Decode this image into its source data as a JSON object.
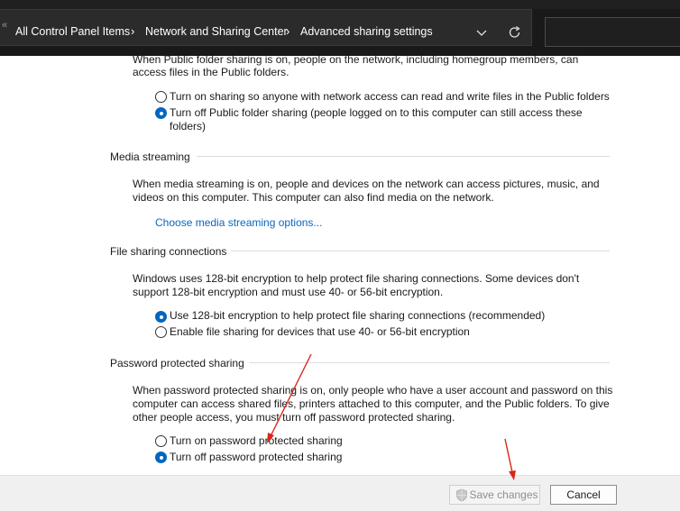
{
  "address_bar": {
    "breadcrumbs": [
      {
        "label": "All Control Panel Items"
      },
      {
        "label": "Network and Sharing Center"
      },
      {
        "label": "Advanced sharing settings"
      }
    ],
    "overflow_glyph": "«",
    "separator_glyph": "›",
    "dropdown_icon": "chevron-down-icon",
    "refresh_icon": "refresh-icon",
    "search_placeholder": ""
  },
  "public_folder": {
    "description_lines": [
      "When Public folder sharing is on, people on the network, including homegroup members, can",
      "access files in the Public folders."
    ],
    "options": [
      {
        "label": "Turn on sharing so anyone with network access can read and write files in the Public folders",
        "checked": false
      },
      {
        "label_lines": [
          "Turn off Public folder sharing (people logged on to this computer can still access these",
          "folders)"
        ],
        "checked": true
      }
    ]
  },
  "media_streaming": {
    "title": "Media streaming",
    "description_lines": [
      "When media streaming is on, people and devices on the network can access pictures, music, and",
      "videos on this computer. This computer can also find media on the network."
    ],
    "link": "Choose media streaming options..."
  },
  "file_sharing": {
    "title": "File sharing connections",
    "description_lines": [
      "Windows uses 128-bit encryption to help protect file sharing connections. Some devices don't",
      "support 128-bit encryption and must use 40- or 56-bit encryption."
    ],
    "options": [
      {
        "label": "Use 128-bit encryption to help protect file sharing connections (recommended)",
        "checked": true
      },
      {
        "label": "Enable file sharing for devices that use 40- or 56-bit encryption",
        "checked": false
      }
    ]
  },
  "password_sharing": {
    "title": "Password protected sharing",
    "description_lines": [
      "When password protected sharing is on, only people who have a user account and password on this",
      "computer can access shared files, printers attached to this computer, and the Public folders. To give",
      "other people access, you must turn off password protected sharing."
    ],
    "options": [
      {
        "label": "Turn on password protected sharing",
        "checked": false
      },
      {
        "label": "Turn off password protected sharing",
        "checked": true
      }
    ]
  },
  "footer": {
    "save_label": "Save changes",
    "save_icon": "shield-icon",
    "save_enabled": false,
    "cancel_label": "Cancel"
  },
  "colors": {
    "accent": "#0067c0",
    "link": "#0a66c2",
    "annotation_arrow": "#d9261c",
    "address_bar_bg": "#2b2b2b"
  }
}
